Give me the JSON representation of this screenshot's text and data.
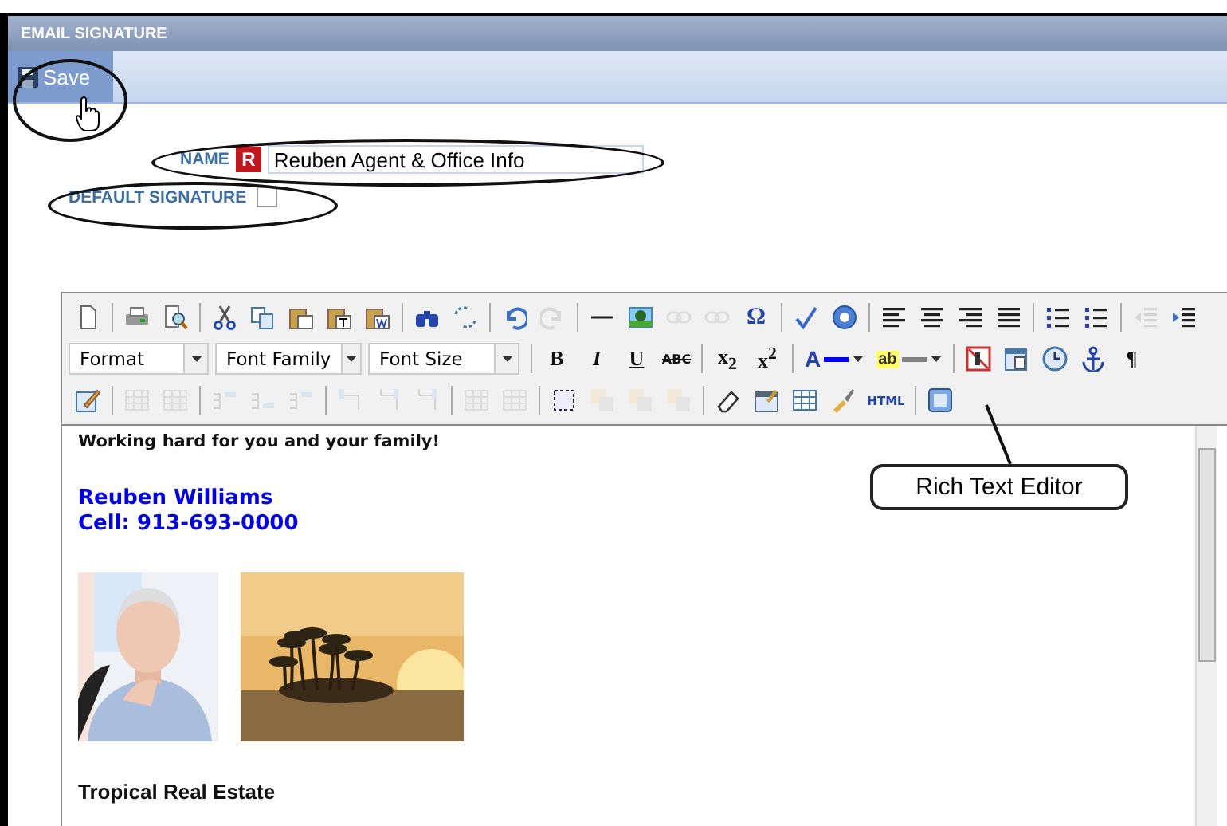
{
  "panel": {
    "title": "EMAIL SIGNATURE"
  },
  "toolbar": {
    "save_button": "Save"
  },
  "name_field": {
    "label": "NAME",
    "badge": "R",
    "value": "Reuben Agent & Office Info"
  },
  "default_signature": {
    "label": "DEFAULT SIGNATURE",
    "checked": false
  },
  "editor": {
    "toolbar_rows": [
      [
        {
          "kind": "icon",
          "disabled": false
        },
        {
          "kind": "separator"
        },
        {
          "kind": "icon",
          "disabled": false
        },
        {
          "kind": "icon",
          "disabled": false
        },
        {
          "kind": "separator"
        },
        {
          "kind": "icon",
          "disabled": false
        },
        {
          "kind": "icon",
          "disabled": false
        },
        {
          "kind": "icon",
          "disabled": false
        },
        {
          "kind": "icon",
          "disabled": false
        },
        {
          "kind": "icon",
          "disabled": false
        },
        {
          "kind": "separator"
        },
        {
          "kind": "icon",
          "disabled": false
        },
        {
          "kind": "icon",
          "disabled": false
        },
        {
          "kind": "separator"
        },
        {
          "kind": "icon",
          "disabled": false
        },
        {
          "kind": "icon",
          "disabled": true
        },
        {
          "kind": "separator"
        },
        {
          "kind": "icon",
          "disabled": false
        },
        {
          "kind": "icon",
          "disabled": false
        },
        {
          "kind": "icon",
          "disabled": true
        },
        {
          "kind": "icon",
          "disabled": true
        },
        {
          "kind": "glyph",
          "label": "Ω"
        },
        {
          "kind": "separator"
        },
        {
          "kind": "icon",
          "disabled": false
        },
        {
          "kind": "icon",
          "disabled": false
        },
        {
          "kind": "separator"
        },
        {
          "kind": "icon",
          "disabled": false
        },
        {
          "kind": "icon",
          "disabled": false
        },
        {
          "kind": "icon",
          "disabled": false
        },
        {
          "kind": "icon",
          "disabled": false
        },
        {
          "kind": "separator"
        },
        {
          "kind": "icon",
          "disabled": false
        },
        {
          "kind": "icon",
          "disabled": false
        },
        {
          "kind": "separator"
        },
        {
          "kind": "icon",
          "disabled": true
        },
        {
          "kind": "icon",
          "disabled": false
        }
      ],
      [
        {
          "kind": "select",
          "label": "Format"
        },
        {
          "kind": "select",
          "label": "Font Family"
        },
        {
          "kind": "select",
          "label": "Font Size"
        },
        {
          "kind": "separator"
        },
        {
          "kind": "glyph",
          "label": "B"
        },
        {
          "kind": "glyph",
          "label": "I"
        },
        {
          "kind": "glyph",
          "label": "U"
        },
        {
          "kind": "glyph",
          "label": "ABC"
        },
        {
          "kind": "separator"
        },
        {
          "kind": "glyph",
          "label": "x$_{2}$"
        },
        {
          "kind": "glyph",
          "label": "x$^{2}$"
        },
        {
          "kind": "separator"
        },
        {
          "kind": "color",
          "label": "A",
          "color": "#0000ff"
        },
        {
          "kind": "color",
          "label": "ab",
          "color": "#808080"
        },
        {
          "kind": "separator"
        },
        {
          "kind": "icon",
          "disabled": false
        },
        {
          "kind": "icon",
          "disabled": false
        },
        {
          "kind": "icon",
          "disabled": false
        },
        {
          "kind": "icon",
          "disabled": false
        },
        {
          "kind": "glyph",
          "label": "¶"
        }
      ],
      [
        {
          "kind": "icon",
          "disabled": false
        },
        {
          "kind": "separator"
        },
        {
          "kind": "icon",
          "disabled": true
        },
        {
          "kind": "icon",
          "disabled": true
        },
        {
          "kind": "separator"
        },
        {
          "kind": "icon",
          "disabled": true
        },
        {
          "kind": "icon",
          "disabled": true
        },
        {
          "kind": "icon",
          "disabled": true
        },
        {
          "kind": "separator"
        },
        {
          "kind": "icon",
          "disabled": true
        },
        {
          "kind": "icon",
          "disabled": true
        },
        {
          "kind": "icon",
          "disabled": true
        },
        {
          "kind": "separator"
        },
        {
          "kind": "icon",
          "disabled": true
        },
        {
          "kind": "icon",
          "disabled": true
        },
        {
          "kind": "separator"
        },
        {
          "kind": "icon",
          "disabled": false
        },
        {
          "kind": "icon",
          "disabled": true
        },
        {
          "kind": "icon",
          "disabled": true
        },
        {
          "kind": "icon",
          "disabled": true
        },
        {
          "kind": "separator"
        },
        {
          "kind": "icon",
          "disabled": false
        },
        {
          "kind": "icon",
          "disabled": false
        },
        {
          "kind": "icon",
          "disabled": false
        },
        {
          "kind": "icon",
          "disabled": false
        },
        {
          "kind": "glyph",
          "label": "HTML"
        },
        {
          "kind": "separator"
        },
        {
          "kind": "icon",
          "disabled": false
        }
      ]
    ],
    "content": [
      {
        "kind": "tagline",
        "text": "Working hard for you and your family!"
      },
      {
        "kind": "contact",
        "text": "Reuben Williams"
      },
      {
        "kind": "contact",
        "text": "Cell: 913-693-0000"
      },
      {
        "kind": "pictures"
      },
      {
        "kind": "heading",
        "text": "Tropical Real Estate"
      }
    ]
  },
  "callout": {
    "text": "Rich Text Editor"
  }
}
